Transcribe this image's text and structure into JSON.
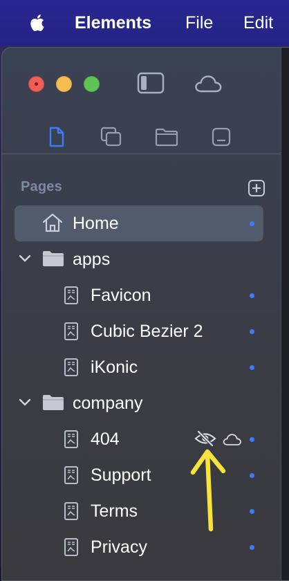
{
  "menubar": {
    "app_name": "Elements",
    "items": [
      "File",
      "Edit"
    ]
  },
  "sidebar": {
    "section_title": "Pages",
    "tree": [
      {
        "label": "Home",
        "type": "home",
        "selected": true
      },
      {
        "label": "apps",
        "type": "folder",
        "expanded": true
      },
      {
        "label": "Favicon",
        "type": "page"
      },
      {
        "label": "Cubic Bezier 2",
        "type": "page"
      },
      {
        "label": "iKonic",
        "type": "page"
      },
      {
        "label": "company",
        "type": "folder",
        "expanded": true
      },
      {
        "label": "404",
        "type": "page",
        "hidden": true,
        "cloud": true
      },
      {
        "label": "Support",
        "type": "page"
      },
      {
        "label": "Terms",
        "type": "page"
      },
      {
        "label": "Privacy",
        "type": "page"
      }
    ]
  },
  "colors": {
    "accent": "#3d7cf5",
    "menubar": "#26268c",
    "annotation_arrow": "#f7e33a"
  },
  "icons": [
    "apple-logo-icon",
    "sidebar-toggle-icon",
    "cloud-icon",
    "page-icon",
    "layers-icon",
    "folder-icon",
    "component-icon",
    "add-page-icon",
    "home-icon",
    "chevron-down-icon",
    "page-file-icon",
    "eye-slash-icon",
    "arrow-annotation"
  ]
}
